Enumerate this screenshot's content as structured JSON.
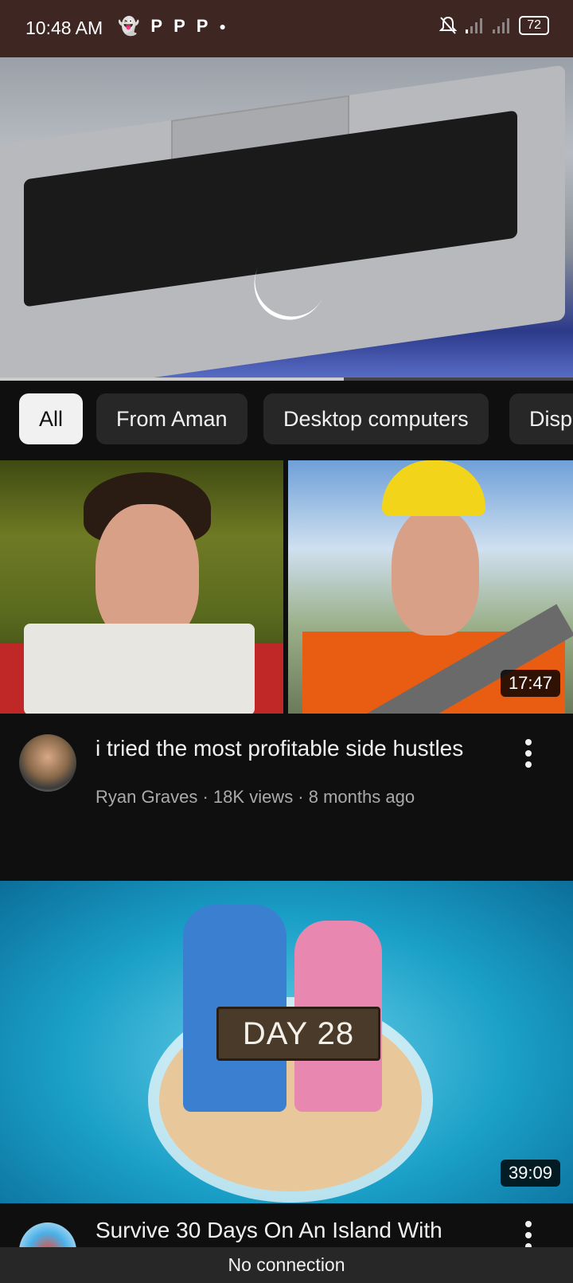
{
  "status_bar": {
    "time": "10:48 AM",
    "notification_icons": [
      "snapchat-icon",
      "p-icon",
      "p-icon",
      "p-icon",
      "dot-icon"
    ],
    "battery": "72"
  },
  "player": {
    "progress_fraction": 0.6
  },
  "chips": [
    {
      "label": "All",
      "active": true
    },
    {
      "label": "From Aman",
      "active": false
    },
    {
      "label": "Desktop computers",
      "active": false
    },
    {
      "label": "Disp",
      "active": false
    }
  ],
  "videos": [
    {
      "title": "i tried the most profitable side hustles",
      "channel": "Ryan Graves",
      "meta": "Ryan Graves · 18K views · 8 months ago",
      "duration": "17:47"
    },
    {
      "title": "Survive 30 Days On An Island With",
      "duration": "39:09",
      "thumbnail_text": "DAY 28"
    }
  ],
  "bottom_bar": {
    "message": "No connection"
  }
}
